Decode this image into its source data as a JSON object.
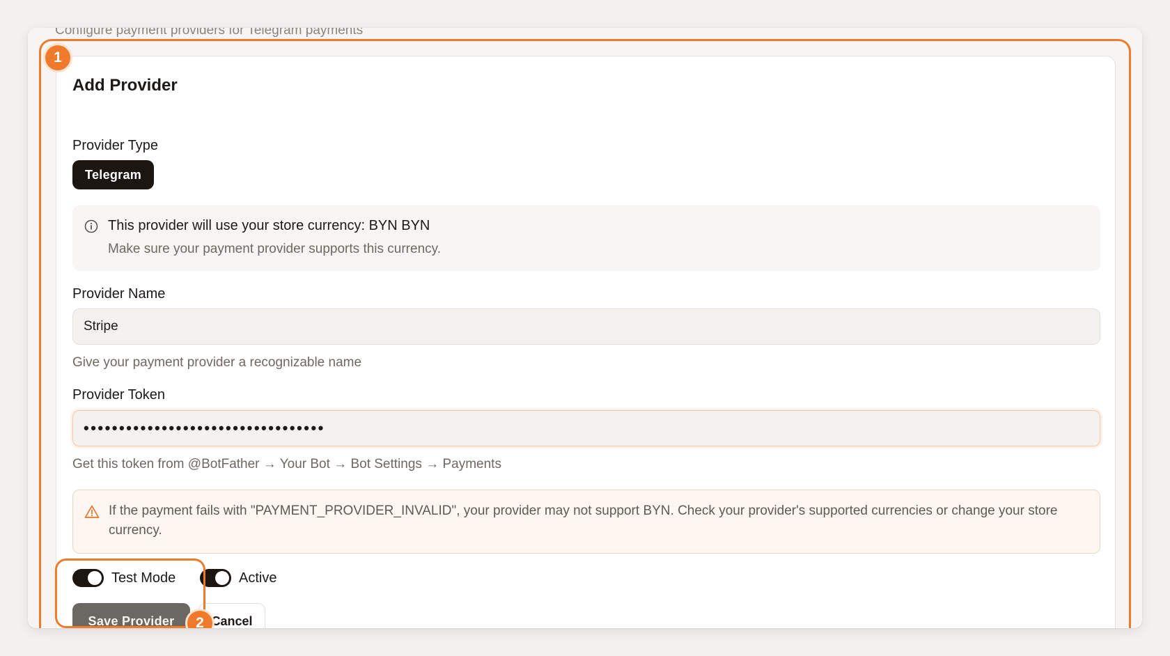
{
  "page": {
    "subtitle": "Configure payment providers for Telegram payments"
  },
  "annotations": {
    "badge_1": "1",
    "badge_2": "2",
    "accent_color": "#f07a2c"
  },
  "form": {
    "title": "Add Provider",
    "provider_type_label": "Provider Type",
    "provider_type_selected": "Telegram",
    "currency_notice": {
      "icon": "info-icon",
      "title": "This provider will use your store currency: BYN BYN",
      "subtitle": "Make sure your payment provider supports this currency."
    },
    "provider_name": {
      "label": "Provider Name",
      "value": "Stripe",
      "helper": "Give your payment provider a recognizable name"
    },
    "provider_token": {
      "label": "Provider Token",
      "value": "••••••••••••••••••••••••••••••••••",
      "helper": "Get this token from @BotFather → Your Bot → Bot Settings → Payments"
    },
    "warning": {
      "icon": "warning-triangle-icon",
      "text": "If the payment fails with \"PAYMENT_PROVIDER_INVALID\", your provider may not support BYN. Check your provider's supported currencies or change your store currency."
    },
    "toggles": {
      "test_mode_label": "Test Mode",
      "test_mode_on": true,
      "active_label": "Active",
      "active_on": true
    },
    "actions": {
      "save_label": "Save Provider",
      "cancel_label": "Cancel"
    }
  }
}
